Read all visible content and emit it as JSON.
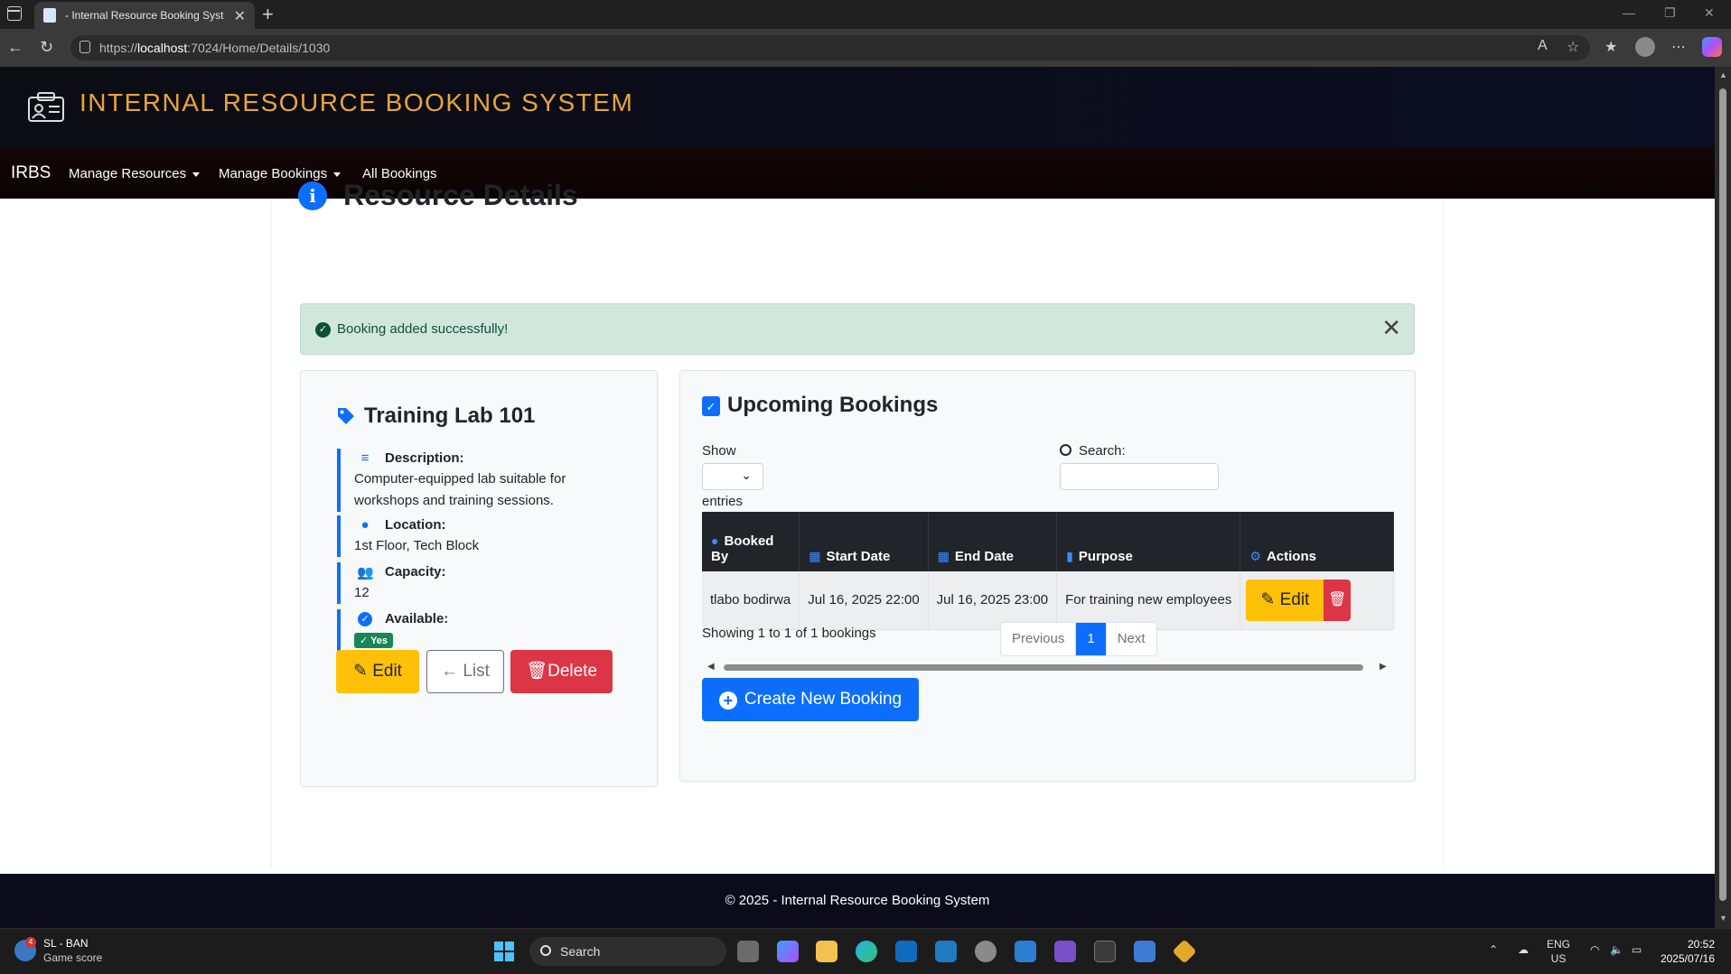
{
  "browser": {
    "tab_title": "- Internal Resource Booking System",
    "url_prefix": "https://",
    "url_host": "localhost",
    "url_rest": ":7024/Home/Details/1030"
  },
  "site": {
    "title": "INTERNAL RESOURCE BOOKING SYSTEM",
    "brand": "IRBS",
    "nav": [
      {
        "label": "Manage Resources"
      },
      {
        "label": "Manage Bookings"
      },
      {
        "label": "All Bookings"
      }
    ],
    "footer": "© 2025 - Internal Resource Booking System"
  },
  "page": {
    "heading": "Resource Details",
    "alert": "Booking added successfully!"
  },
  "resource": {
    "name": "Training Lab 101",
    "fields": {
      "description_label": "Description:",
      "description": "Computer-equipped lab suitable for workshops and training sessions.",
      "location_label": "Location:",
      "location": "1st Floor, Tech Block",
      "capacity_label": "Capacity:",
      "capacity": "12",
      "available_label": "Available:",
      "available": "Yes"
    },
    "buttons": {
      "edit": "Edit",
      "list": "List",
      "delete": "Delete"
    }
  },
  "bookings": {
    "title": "Upcoming Bookings",
    "show_label": "Show",
    "entries_label": "entries",
    "search_label": "Search:",
    "columns": [
      "Booked By",
      "Start Date",
      "End Date",
      "Purpose",
      "Actions"
    ],
    "rows": [
      {
        "booked_by": "tlabo bodirwa",
        "start": "Jul 16, 2025 22:00",
        "end": "Jul 16, 2025 23:00",
        "purpose": "For training new employees",
        "edit": "Edit"
      }
    ],
    "info": "Showing 1 to 1 of 1 bookings",
    "pager": {
      "previous": "Previous",
      "page": "1",
      "next": "Next"
    },
    "create_button": "Create New Booking"
  },
  "taskbar": {
    "weather_line1": "SL - BAN",
    "weather_line2": "Game score",
    "badge": "4",
    "search": "Search",
    "lang1": "ENG",
    "lang2": "US",
    "time": "20:52",
    "date": "2025/07/16"
  },
  "colors": {
    "brand_title": "#e8a53a",
    "primary": "#0d6efd",
    "warning": "#ffc107",
    "danger": "#dc3545",
    "success_bg": "#d1e7dd"
  }
}
